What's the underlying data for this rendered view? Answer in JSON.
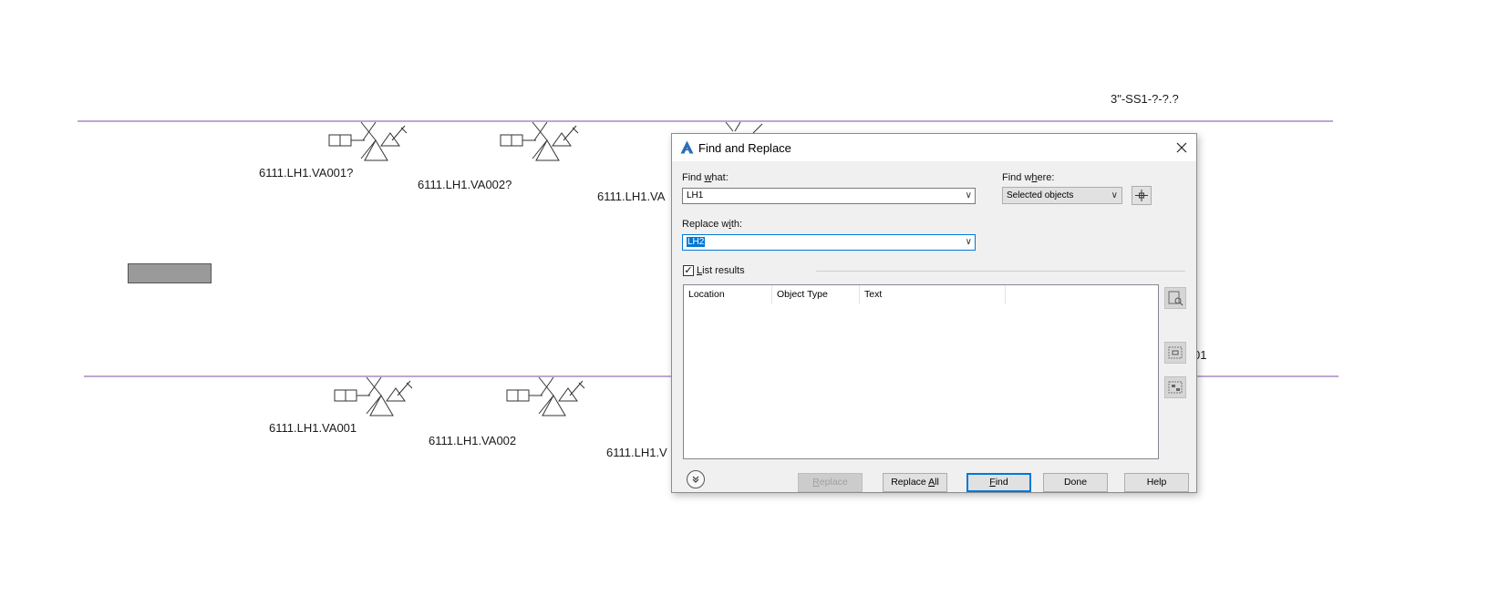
{
  "canvas": {
    "line_color": "#9b72b8",
    "labels": {
      "top_pipe": "3\"-SS1-?-?.?",
      "upper_v1": "6111.LH1.VA001?",
      "upper_v2": "6111.LH1.VA002?",
      "upper_v3": "6111.LH1.VA",
      "lower_v1": "6111.LH1.VA001",
      "lower_v2": "6111.LH1.VA002",
      "lower_v3": "6111.LH1.V",
      "right_fragment": "01"
    }
  },
  "dialog": {
    "title": "Find and Replace",
    "close_icon": "close-icon",
    "find_what": {
      "label_pre": "Find ",
      "label_u": "w",
      "label_post": "hat:",
      "value": "LH1"
    },
    "find_where": {
      "label_pre": "Find w",
      "label_u": "h",
      "label_post": "ere:",
      "value": "Selected objects"
    },
    "replace_with": {
      "label_pre": "Replace w",
      "label_u": "i",
      "label_post": "th:",
      "value": "LH2"
    },
    "list_results": {
      "label_u": "L",
      "label_post": "ist results",
      "checked": true
    },
    "columns": [
      "Location",
      "Object Type",
      "Text"
    ],
    "buttons": {
      "replace_u": "R",
      "replace_post": "eplace",
      "replace_all_pre": "Replace ",
      "replace_all_u": "A",
      "replace_all_post": "ll",
      "find_u": "F",
      "find_post": "ind",
      "done": "Done",
      "help": "Help"
    }
  }
}
